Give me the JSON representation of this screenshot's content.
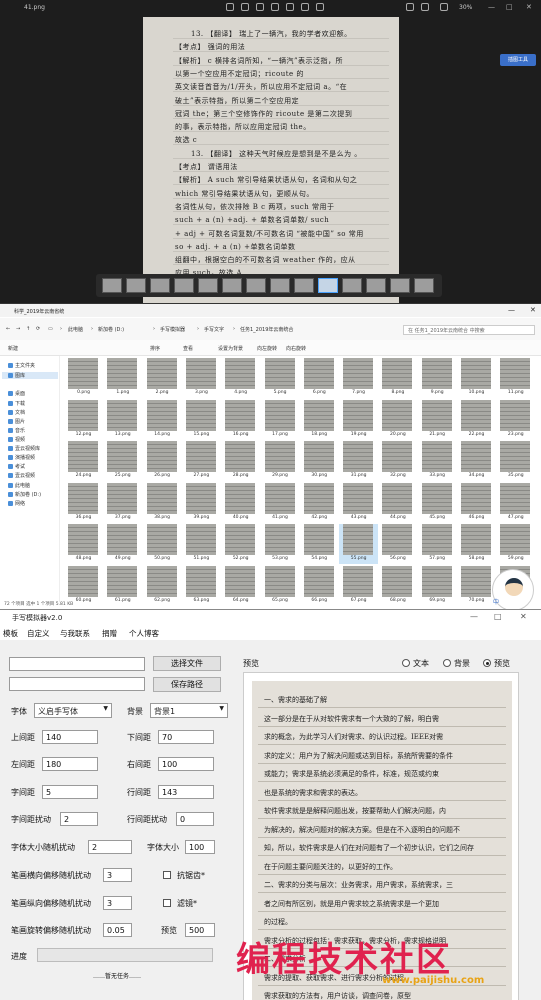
{
  "viewer": {
    "title": "41.png",
    "zoom": "30%",
    "side_label": "插图工具",
    "handwriting": [
      "13. 【翻译】 瑞上了一辆汽，我的学者欢迎额。",
      "【考点】 强词的用法",
      "【解析】 c 横排名词所知，“一辆汽”表示泛指，所",
      "以第一个空应用不定冠词；ricoute 的",
      "英文读音首音为/1/开头，所以应用不定冠词 a。“在",
      "破土”表示特指，所以第二个空应用定",
      "冠词 the；第三个空修饰作的 ricoute 是第二次提到",
      "的事，表示特指，所以应用定冠词 the。",
      "故选 c",
      "13. 【翻译】 这种天气时候应是想到是不是么为 。",
      "【考点】 谓语用法",
      "【解析】 A such 常引导结果状语从句，名词和从句之",
      "which 常引导结果状语从句，更顺从句。",
      "名词性从句，依次排除 B c 两项，such 常用于",
      "such + a (n) +adj. + 单数名词单数/ such",
      "+ adj + 可数名词复数/不可数名词 “被能中国” so 常用",
      "so + adj. + a (n) +单数名词单数",
      "组翻中，根据空白的不可数名词 weather 作的，应从",
      "应用 such。故选 A",
      "(c 【翻译】—些子了些以为事情 )"
    ]
  },
  "explorer": {
    "window_title": "科学_2019年云南省统",
    "crumbs": [
      "此电脑",
      "新加卷 (D:)",
      "手写模拟器",
      "手写文字",
      "任务1_2019年云南统合"
    ],
    "search_placeholder": "在 任务1_2019年云南统合 中搜索",
    "toolbar": [
      "新建",
      "排序",
      "查看",
      "设置为背景",
      "向左旋转",
      "向右旋转"
    ],
    "nav": [
      "主文件夹",
      "图库",
      "桌面",
      "下载",
      "文档",
      "图片",
      "音乐",
      "视频",
      "壹云视频库",
      "演播视频",
      "考试",
      "壹云视频",
      "此电脑",
      "新加卷 (D:)",
      "网络"
    ],
    "files": [
      "0.png",
      "1.png",
      "2.png",
      "3.png",
      "4.png",
      "5.png",
      "6.png",
      "7.png",
      "8.png",
      "9.png",
      "10.png",
      "11.png",
      "12.png",
      "13.png",
      "14.png",
      "15.png",
      "16.png",
      "17.png",
      "18.png",
      "19.png",
      "20.png",
      "21.png",
      "22.png",
      "23.png",
      "24.png",
      "25.png",
      "26.png",
      "27.png",
      "28.png",
      "29.png",
      "30.png",
      "31.png",
      "32.png",
      "33.png",
      "34.png",
      "35.png",
      "36.png",
      "37.png",
      "38.png",
      "39.png",
      "40.png",
      "41.png",
      "42.png",
      "43.png",
      "44.png",
      "45.png",
      "46.png",
      "47.png",
      "48.png",
      "49.png",
      "50.png",
      "51.png",
      "52.png",
      "53.png",
      "54.png",
      "55.png",
      "56.png",
      "57.png",
      "58.png",
      "59.png",
      "60.png",
      "61.png",
      "62.png",
      "63.png",
      "64.png",
      "65.png",
      "66.png",
      "67.png",
      "68.png",
      "69.png",
      "70.png",
      "71.png"
    ],
    "selected_index": 55,
    "status": "72 个项目    选中 1 个项目 5.81 KB",
    "assistant_label": "中"
  },
  "sim": {
    "title": "手写模拟器v2.0",
    "menu": [
      "模板",
      "自定义",
      "与我联系",
      "捐赠",
      "个人博客"
    ],
    "choose_file": "选择文件",
    "save_path": "保存路径",
    "font_label": "字体",
    "font_value": "义启手写体",
    "bg_label": "背景",
    "bg_value": "背景1",
    "fields": {
      "top_margin_label": "上间距",
      "top_margin": "140",
      "bottom_margin_label": "下间距",
      "bottom_margin": "70",
      "left_margin_label": "左间距",
      "left_margin": "180",
      "right_margin_label": "右间距",
      "right_margin": "100",
      "char_spacing_label": "字间距",
      "char_spacing": "5",
      "line_spacing_label": "行间距",
      "line_spacing": "143",
      "char_jitter_label": "字间距扰动",
      "char_jitter": "2",
      "line_jitter_label": "行间距扰动",
      "line_jitter": "0",
      "size_jitter_label": "字体大小随机扰动",
      "size_jitter": "2",
      "font_size_label": "字体大小",
      "font_size": "100",
      "h_offset_label": "笔画横向偏移随机扰动",
      "h_offset": "3",
      "v_offset_label": "笔画纵向偏移随机扰动",
      "v_offset": "3",
      "rotate_label": "笔画旋转偏移随机扰动",
      "rotate": "0.05",
      "preview_label": "预览",
      "preview_size": "500"
    },
    "antialias": "抗锯齿*",
    "blur": "滤镜*",
    "progress_label": "进度",
    "task_status": "……暂无任务……",
    "preview_title": "预览",
    "radio": [
      "文本",
      "背景",
      "预览"
    ],
    "preview_lines": [
      "一、需求的基础了解",
      "这一部分是在于从对软件需求有一个大致的了解，明白需",
      "求的概念，为此学习人们对需求、的认识过程。IEEE对需",
      "求的定义：用户为了解决问题或达到目标，系统所需要的条件",
      "或能力；需求是系统必须满足的条件，标准，规范或约束",
      "也是系统的需求和需求的表达。",
      "软件需求就是是解释问题出发，按要帮助人们解决问题，内",
      "为解决的，解决问题对的解决方案。但是在不入逐明白的问题不",
      "知，所以，软件需求是人们在对问题有了一个初步认识，它们之间存",
      "在于问题主要问题关注的，以更好的工作。",
      "二、需求的分类与层次：业务需求，用户需求，系统需求，三",
      "者之间有所区别，就是用户需求较之系统需求是一个更加",
      "的过程。",
      "需求分析的过程包括：需求获取，需求分析，需求规格说明",
      "二、需求分析",
      "需求的提取、获取需求、进行需求分析的过程",
      "需求获取的方法有，用户访谈，调查问卷，原型"
    ],
    "watermark": "编程技术社区",
    "watermark_url": "www.paijishu.com"
  }
}
